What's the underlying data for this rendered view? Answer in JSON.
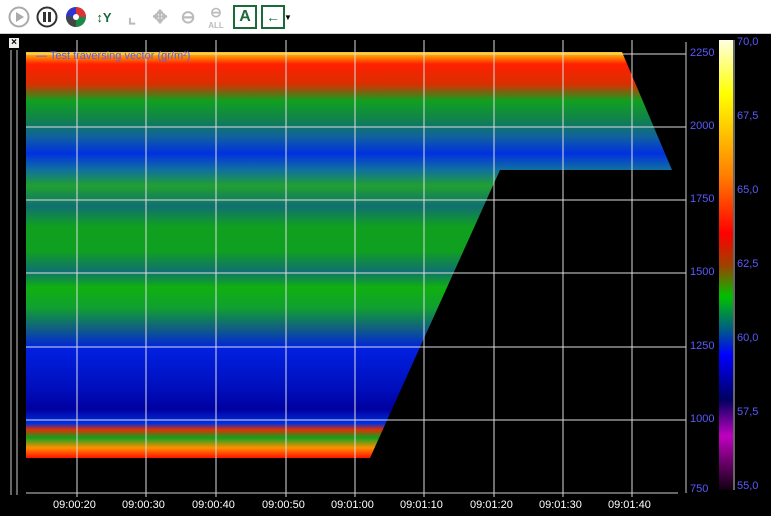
{
  "toolbar": {
    "buttons": [
      {
        "name": "play-icon"
      },
      {
        "name": "pause-icon"
      },
      {
        "name": "color-palette-icon"
      },
      {
        "name": "autoscale-y-icon",
        "label": "Y"
      },
      {
        "name": "axis-icon"
      },
      {
        "name": "pan-icon"
      },
      {
        "name": "zoom-out-icon"
      },
      {
        "name": "zoom-out-all-icon",
        "label": "ALL"
      },
      {
        "name": "annotation-icon",
        "label": "A"
      },
      {
        "name": "back-icon"
      }
    ]
  },
  "legend": {
    "label": "Test traversing vector (gr/m²)"
  },
  "y_axis": {
    "ticks": [
      "2250",
      "2000",
      "1750",
      "1500",
      "1250",
      "1000",
      "750"
    ]
  },
  "x_axis": {
    "ticks": [
      "09:00:20",
      "09:00:30",
      "09:00:40",
      "09:00:50",
      "09:01:00",
      "09:01:10",
      "09:01:20",
      "09:01:30",
      "09:01:40"
    ]
  },
  "colorbar": {
    "ticks": [
      "70,0",
      "67,5",
      "65,0",
      "62,5",
      "60,0",
      "57,5",
      "55,0"
    ]
  },
  "close_label": "×"
}
